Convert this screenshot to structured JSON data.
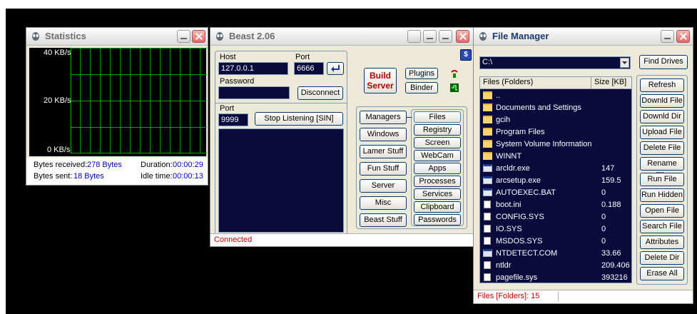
{
  "statistics": {
    "title": "Statistics",
    "y_labels": [
      "40 KB/s",
      "20 KB/s",
      "0 KB/s"
    ],
    "bytes_received_label": "Bytes received:",
    "bytes_received_value": "278 Bytes",
    "bytes_sent_label": "Bytes sent:",
    "bytes_sent_value": "18 Bytes",
    "duration_label": "Duration:",
    "duration_value": "00:00:29",
    "idle_label": "Idle time:",
    "idle_value": "00:00:13"
  },
  "beast": {
    "title": "Beast 2.06",
    "host_label": "Host",
    "host_value": "127.0.0.1",
    "port_label": "Port",
    "port_value": "6666",
    "password_label": "Password",
    "password_value": "",
    "disconnect_label": "Disconnect",
    "build_server_label": "Build Server",
    "plugins_label": "Plugins",
    "binder_label": "Binder",
    "listen_port_label": "Port",
    "listen_port_value": "9999",
    "stop_listening_label": "Stop Listening [SIN]",
    "left_menu": [
      "Managers",
      "Windows",
      "Lamer Stuff",
      "Fun Stuff",
      "Server",
      "Misc",
      "Beast Stuff"
    ],
    "right_menu": [
      "Files",
      "Registry",
      "Screen",
      "WebCam",
      "Apps",
      "Processes",
      "Services",
      "Clipboard",
      "Passwords"
    ],
    "status": "Connected"
  },
  "file_manager": {
    "title": "File Manager",
    "path": "C:\\",
    "find_drives_label": "Find Drives",
    "col_name": "Files (Folders)",
    "col_size": "Size [KB]",
    "rows": [
      {
        "type": "folder",
        "name": "..",
        "size": ""
      },
      {
        "type": "folder",
        "name": "Documents and Settings",
        "size": ""
      },
      {
        "type": "folder",
        "name": "gcih",
        "size": ""
      },
      {
        "type": "folder",
        "name": "Program Files",
        "size": ""
      },
      {
        "type": "folder",
        "name": "System Volume Information",
        "size": ""
      },
      {
        "type": "folder",
        "name": "WINNT",
        "size": ""
      },
      {
        "type": "exe",
        "name": "arcldr.exe",
        "size": "147"
      },
      {
        "type": "exe",
        "name": "arcsetup.exe",
        "size": "159.5"
      },
      {
        "type": "exe",
        "name": "AUTOEXEC.BAT",
        "size": "0"
      },
      {
        "type": "file",
        "name": "boot.ini",
        "size": "0.188"
      },
      {
        "type": "file",
        "name": "CONFIG.SYS",
        "size": "0"
      },
      {
        "type": "file",
        "name": "IO.SYS",
        "size": "0"
      },
      {
        "type": "file",
        "name": "MSDOS.SYS",
        "size": "0"
      },
      {
        "type": "exe",
        "name": "NTDETECT.COM",
        "size": "33.66"
      },
      {
        "type": "file",
        "name": "ntldr",
        "size": "209.406"
      },
      {
        "type": "file",
        "name": "pagefile.sys",
        "size": "393216"
      }
    ],
    "actions": [
      "Refresh",
      "Downld File",
      "Downld Dir",
      "Upload File",
      "Delete File",
      "Rename File",
      "Run File",
      "Run Hidden",
      "Open File",
      "Search File",
      "Attributes",
      "Delete Dir",
      "Erase All"
    ],
    "status": "Files [Folders]: 15"
  }
}
